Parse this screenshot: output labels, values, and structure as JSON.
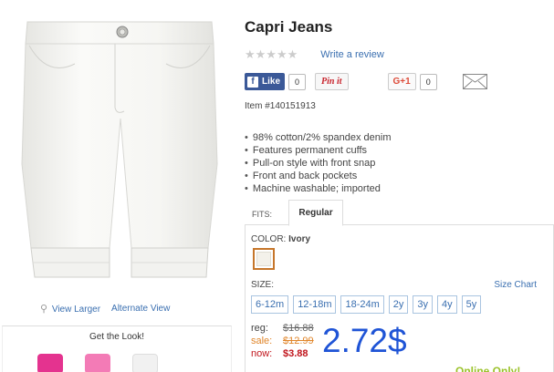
{
  "product": {
    "title": "Capri Jeans",
    "item_number": "Item #140151913",
    "features": [
      "98% cotton/2% spandex denim",
      "Features permanent cuffs",
      "Pull-on style with front snap",
      "Front and back pockets",
      "Machine washable; imported"
    ]
  },
  "rating": {
    "stars": "★★★★★",
    "write_review": "Write a review"
  },
  "social": {
    "fb_like": "Like",
    "fb_count": "0",
    "pin_label": "Pin it",
    "gplus_label": "G+1",
    "gplus_count": "0"
  },
  "image_links": {
    "view_larger": "View Larger",
    "alternate_view": "Alternate View"
  },
  "get_the_look": "Get the Look!",
  "fits": {
    "label": "FITS:",
    "selected_tab": "Regular"
  },
  "color": {
    "label": "COLOR:",
    "value": "Ivory",
    "swatch_hex": "#f3f1ea"
  },
  "size": {
    "label": "SIZE:",
    "chart_link": "Size Chart",
    "options": [
      "6-12m",
      "12-18m",
      "18-24m",
      "2y",
      "3y",
      "4y",
      "5y"
    ]
  },
  "pricing": {
    "reg_label": "reg:",
    "reg_value": "$16.88",
    "sale_label": "sale:",
    "sale_value": "$12.99",
    "now_label": "now:",
    "now_value": "$3.88",
    "overlay_price": "2.72$",
    "online_only": "Online Only!"
  },
  "colors": {
    "link_blue": "#3a6fb0",
    "sale_orange": "#e0862b",
    "now_red": "#c0141b",
    "overlay_blue": "#1f54d6",
    "online_green": "#9bc22a"
  }
}
